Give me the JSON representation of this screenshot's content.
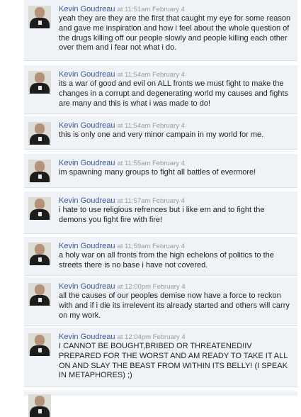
{
  "posts": [
    {
      "author": "Kevin Goudreau",
      "time": "at 11:51am February 4",
      "text": "yeah they are they are the first that caught my eye for some reason and gave me inspiration and how i feel about the whole question of the drugs killing off our people slowly and people killing each other over them and i fear not what i do."
    },
    {
      "author": "Kevin Goudreau",
      "time": "at 11:54am February 4",
      "text": "its a war of good and evil on ALL fronts we must fight to make the changes in a corrupt and degenerating world my causes and fights are many and this is what i was made to do!"
    },
    {
      "author": "Kevin Goudreau",
      "time": "at 11:54am February 4",
      "text": "this is only one and very minor campain in my world for me."
    },
    {
      "author": "Kevin Goudreau",
      "time": "at 11:55am February 4",
      "text": "im spawning many groups to fight all battles of evermore!"
    },
    {
      "author": "Kevin Goudreau",
      "time": "at 11:57am February 4",
      "text": "i hate to use religious refrences but i like em and to fight the demons you fight fire with fire!"
    },
    {
      "author": "Kevin Goudreau",
      "time": "at 11:59am February 4",
      "text": "a holy war on all fronts from the high echelons of politics to the streets there is no base i have not covered."
    },
    {
      "author": "Kevin Goudreau",
      "time": "at 12:00pm February 4",
      "text": "all the causes of our peoples demise now have a force to reckon with and if i die its irrelevent its already started and others will carry on my work."
    },
    {
      "author": "Kevin Goudreau",
      "time": "at 12:04pm February 4",
      "text": "I CANNOT BE BOUGHT,BRIBED OR THREATENED!IV PREPARED FOR THE WORST AND AM READY TO TAKE IT ALL ON AND SLAY THE BEAST FROM WITHIN ITS BELLY! (I SPEAK IN METAPHORES) ;)"
    },
    {
      "author": "",
      "time": "",
      "text": ""
    }
  ]
}
